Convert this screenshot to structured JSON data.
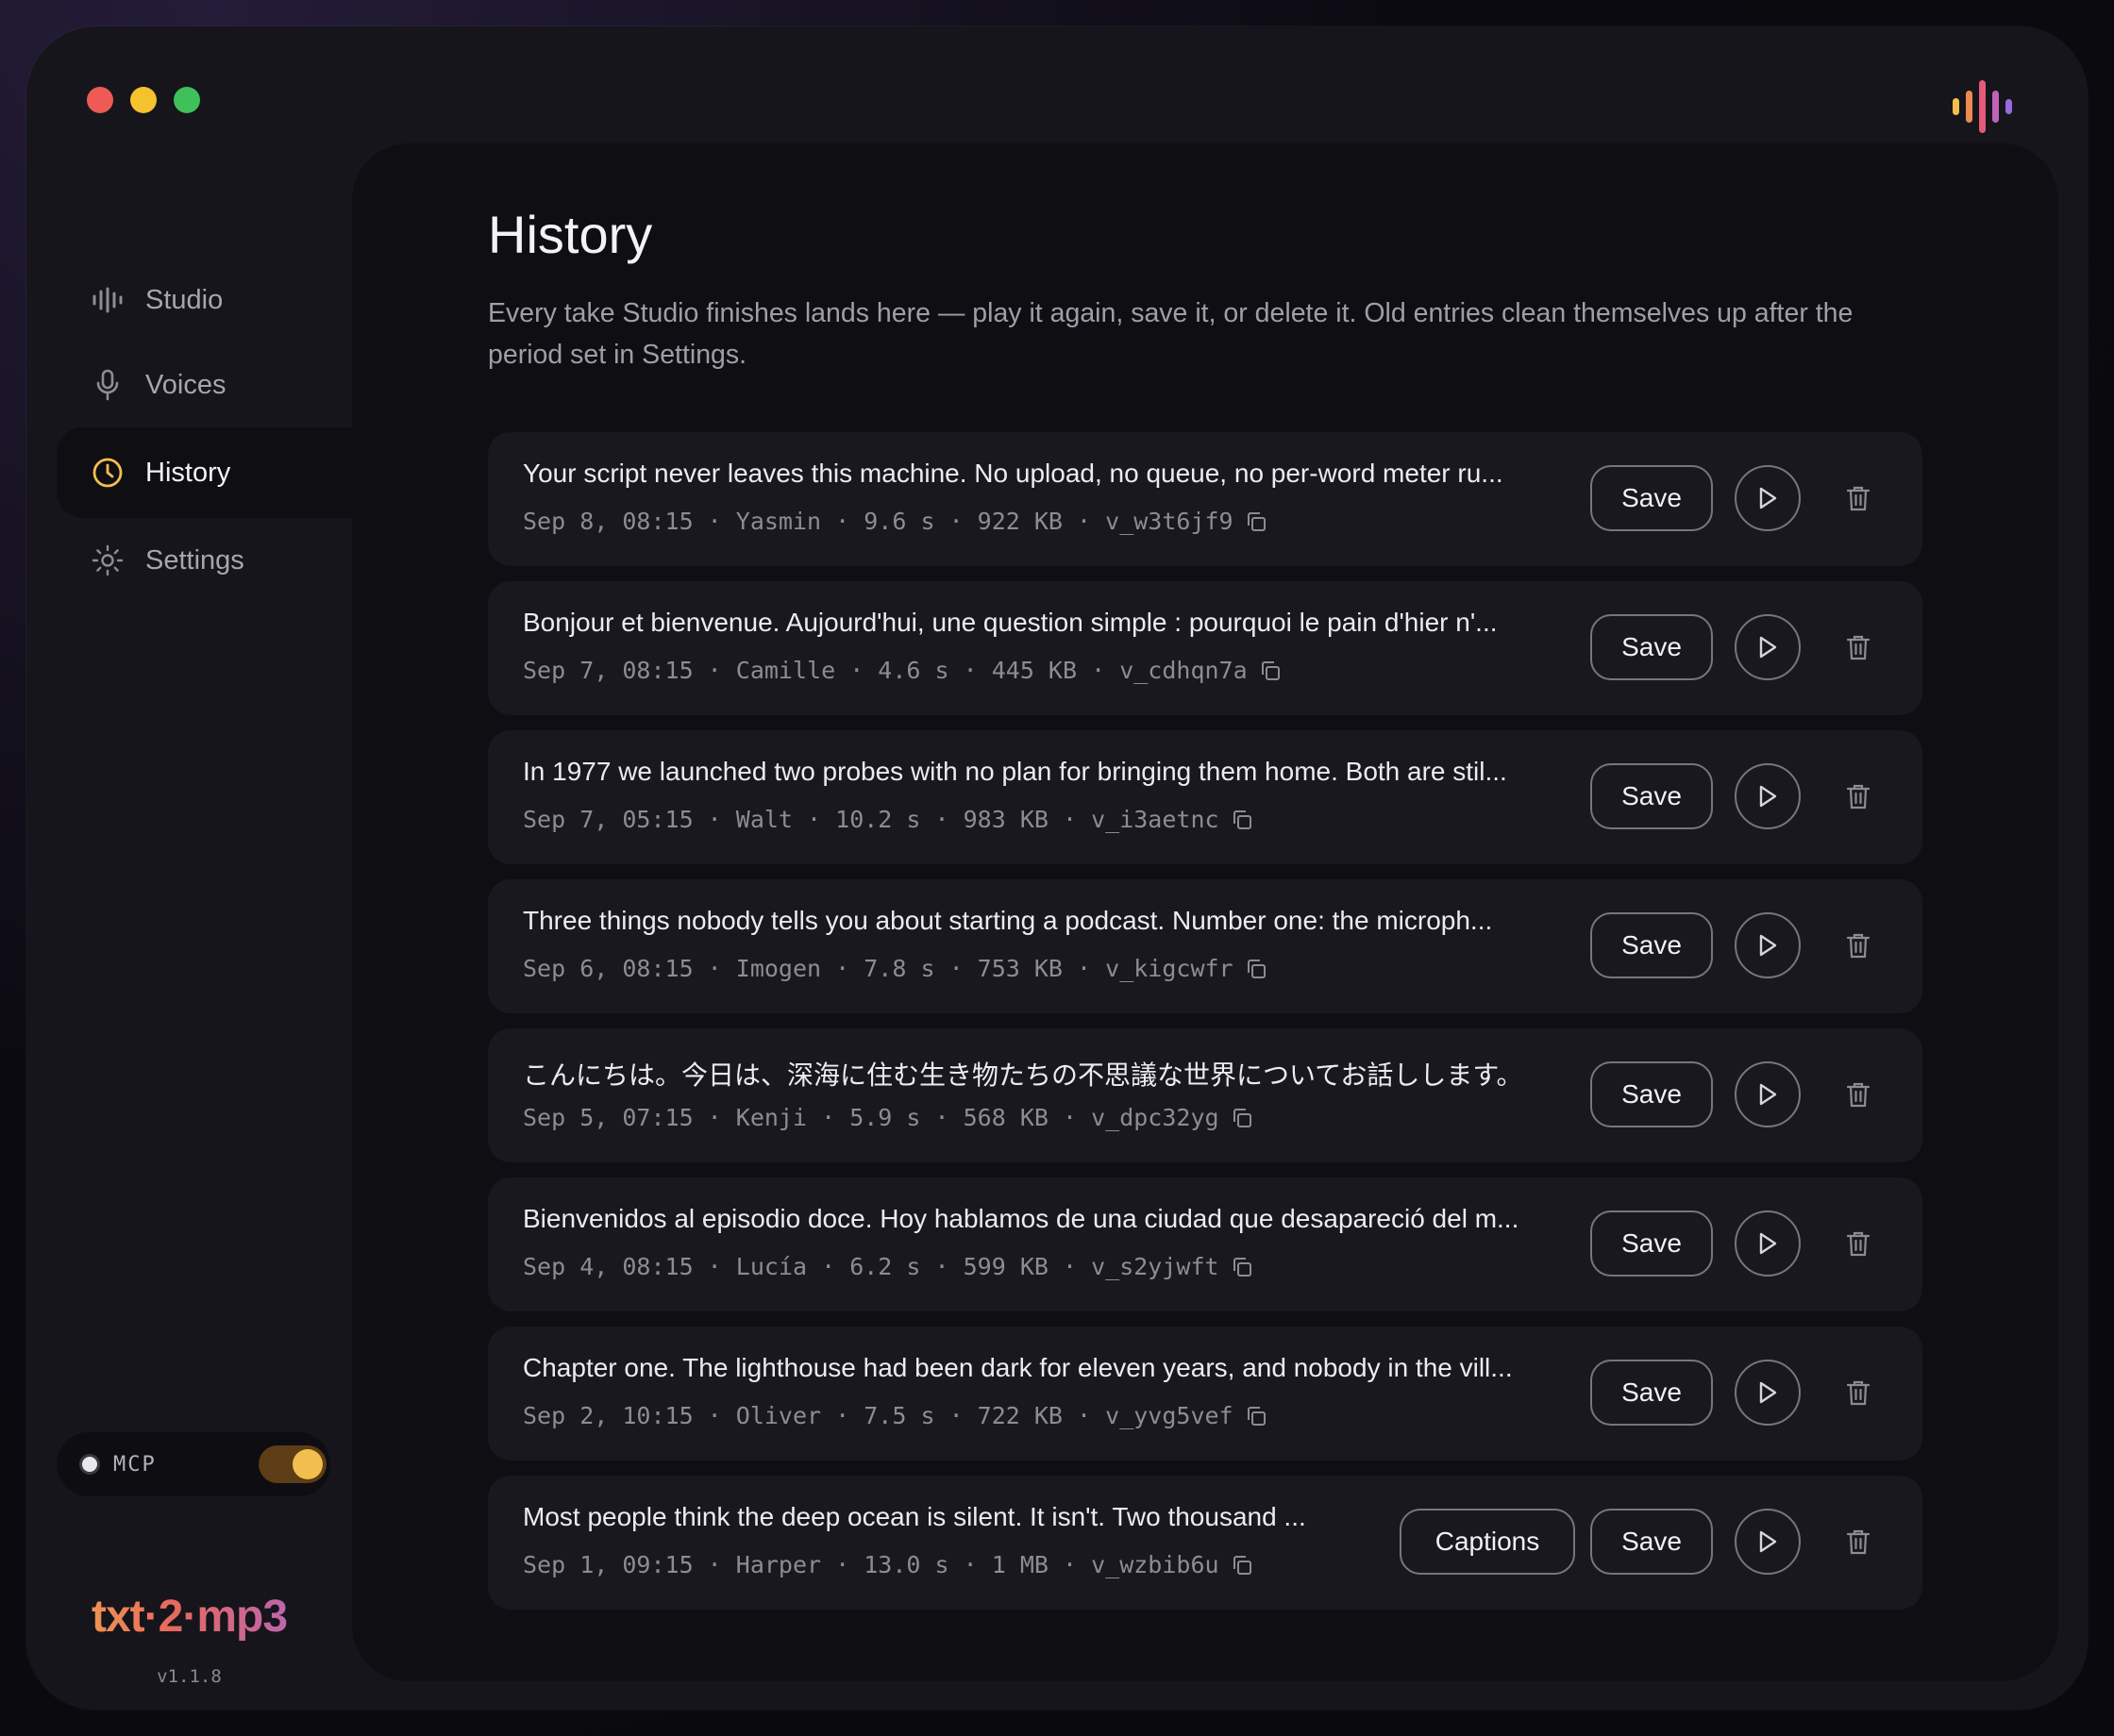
{
  "sidebar": {
    "items": [
      {
        "label": "Studio",
        "icon": "waveform-icon",
        "active": false
      },
      {
        "label": "Voices",
        "icon": "microphone-icon",
        "active": false
      },
      {
        "label": "History",
        "icon": "clock-icon",
        "active": true
      },
      {
        "label": "Settings",
        "icon": "gear-icon",
        "active": false
      }
    ],
    "mcp_label": "MCP",
    "mcp_enabled": true,
    "logo": "txt·2·mp3",
    "version": "v1.1.8"
  },
  "colors": {
    "accent": "#f2bf4e",
    "window_bg": "#16151b",
    "panel_bg": "#0f0e13",
    "row_bg": "#19181e"
  },
  "page": {
    "title": "History",
    "subtitle": "Every take Studio finishes lands here — play it again, save it, or delete it. Old entries clean themselves up after the period set in Settings."
  },
  "buttons": {
    "save": "Save",
    "captions": "Captions"
  },
  "history": [
    {
      "text": "Your script never leaves this machine. No upload, no queue, no per-word meter ru...",
      "date": "Sep 8, 08:15",
      "voice": "Yasmin",
      "duration": "9.6 s",
      "size": "922 KB",
      "id": "v_w3t6jf9",
      "captions": false
    },
    {
      "text": "Bonjour et bienvenue. Aujourd'hui, une question simple : pourquoi le pain d'hier n'...",
      "date": "Sep 7, 08:15",
      "voice": "Camille",
      "duration": "4.6 s",
      "size": "445 KB",
      "id": "v_cdhqn7a",
      "captions": false
    },
    {
      "text": "In 1977 we launched two probes with no plan for bringing them home. Both are stil...",
      "date": "Sep 7, 05:15",
      "voice": "Walt",
      "duration": "10.2 s",
      "size": "983 KB",
      "id": "v_i3aetnc",
      "captions": false
    },
    {
      "text": "Three things nobody tells you about starting a podcast. Number one: the microph...",
      "date": "Sep 6, 08:15",
      "voice": "Imogen",
      "duration": "7.8 s",
      "size": "753 KB",
      "id": "v_kigcwfr",
      "captions": false
    },
    {
      "text": "こんにちは。今日は、深海に住む生き物たちの不思議な世界についてお話しします。",
      "date": "Sep 5, 07:15",
      "voice": "Kenji",
      "duration": "5.9 s",
      "size": "568 KB",
      "id": "v_dpc32yg",
      "captions": false
    },
    {
      "text": "Bienvenidos al episodio doce. Hoy hablamos de una ciudad que desapareció del m...",
      "date": "Sep 4, 08:15",
      "voice": "Lucía",
      "duration": "6.2 s",
      "size": "599 KB",
      "id": "v_s2yjwft",
      "captions": false
    },
    {
      "text": "Chapter one. The lighthouse had been dark for eleven years, and nobody in the vill...",
      "date": "Sep 2, 10:15",
      "voice": "Oliver",
      "duration": "7.5 s",
      "size": "722 KB",
      "id": "v_yvg5vef",
      "captions": false
    },
    {
      "text": "Most people think the deep ocean is silent. It isn't. Two thousand ...",
      "date": "Sep 1, 09:15",
      "voice": "Harper",
      "duration": "13.0 s",
      "size": "1 MB",
      "id": "v_wzbib6u",
      "captions": true
    }
  ]
}
